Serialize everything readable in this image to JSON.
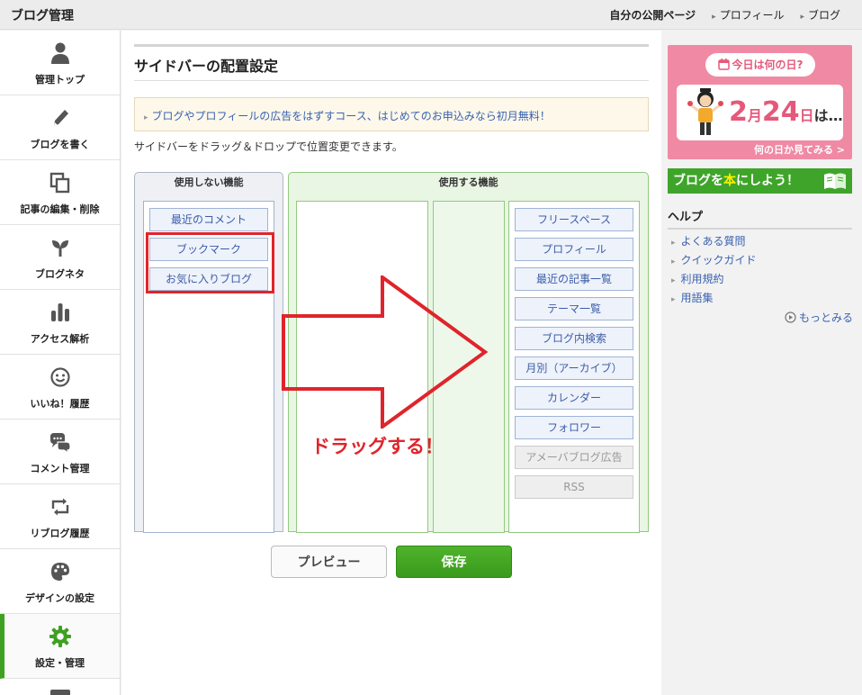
{
  "app": {
    "title": "ブログ管理"
  },
  "top_links": {
    "public_page": "自分の公開ページ",
    "profile": "プロフィール",
    "blog": "ブログ"
  },
  "sidebar": {
    "items": [
      {
        "label": "管理トップ",
        "icon": "person-icon"
      },
      {
        "label": "ブログを書く",
        "icon": "pencil-icon"
      },
      {
        "label": "記事の編集・削除",
        "icon": "documents-icon"
      },
      {
        "label": "ブログネタ",
        "icon": "sprout-icon"
      },
      {
        "label": "アクセス解析",
        "icon": "bar-chart-icon"
      },
      {
        "label": "いいね！履歴",
        "icon": "smile-icon"
      },
      {
        "label": "コメント管理",
        "icon": "comment-icon"
      },
      {
        "label": "リブログ履歴",
        "icon": "reblog-icon"
      },
      {
        "label": "デザインの設定",
        "icon": "palette-icon"
      },
      {
        "label": "設定・管理",
        "icon": "gear-icon",
        "active": true
      }
    ]
  },
  "main": {
    "title": "サイドバーの配置設定",
    "notice": "ブログやプロフィールの広告をはずすコース、はじめてのお申込みなら初月無料！",
    "hint": "サイドバーをドラッグ＆ドロップで位置変更できます。",
    "unused": {
      "header": "使用しない機能",
      "items": [
        "最近のコメント",
        "ブックマーク",
        "お気に入りブログ"
      ]
    },
    "used": {
      "header": "使用する機能",
      "items": [
        "フリースペース",
        "プロフィール",
        "最近の記事一覧",
        "テーマ一覧",
        "ブログ内検索",
        "月別（アーカイブ）",
        "カレンダー",
        "フォロワー"
      ],
      "disabled_items": [
        "アメーバブログ広告",
        "RSS"
      ]
    },
    "annotation": "ドラッグする！",
    "preview_label": "プレビュー",
    "save_label": "保存"
  },
  "right": {
    "banner1": {
      "pill": "今日は何の日?",
      "month": "2",
      "month_unit": "月",
      "day": "24",
      "day_unit": "日",
      "suffix": "は…",
      "link": "何の日か見てみる >"
    },
    "banner2": {
      "pre": "ブログを",
      "highlight": "本",
      "post": "にしよう！"
    },
    "help": {
      "title": "ヘルプ",
      "links": [
        "よくある質問",
        "クイックガイド",
        "利用規約",
        "用語集"
      ],
      "more": "もっとみる"
    }
  },
  "colors": {
    "accent_green": "#3ea121",
    "annotation_red": "#e0242b",
    "link_blue": "#3a62b0",
    "banner_pink": "#f08aa4"
  }
}
